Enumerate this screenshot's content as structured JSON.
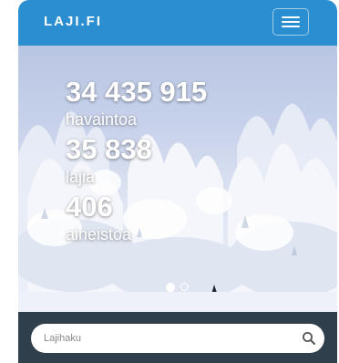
{
  "navbar": {
    "brand": "LAJI.FI",
    "menu_icon": "hamburger-menu-icon",
    "background": "#2b8ed1"
  },
  "hero": {
    "stats": [
      {
        "value": "34 435 915",
        "label": "havaintoa"
      },
      {
        "value": "35 838",
        "label": "lajia"
      },
      {
        "value": "406",
        "label": "aineistoa"
      }
    ],
    "prev_icon": "chevron-left-icon",
    "next_icon": "chevron-right-icon",
    "prev_glyph": "‹",
    "next_glyph": "›",
    "slides_total": 2,
    "active_slide": 1
  },
  "search": {
    "placeholder": "Lajihaku",
    "icon": "search-icon",
    "bar_background": "#2f3f4c"
  }
}
